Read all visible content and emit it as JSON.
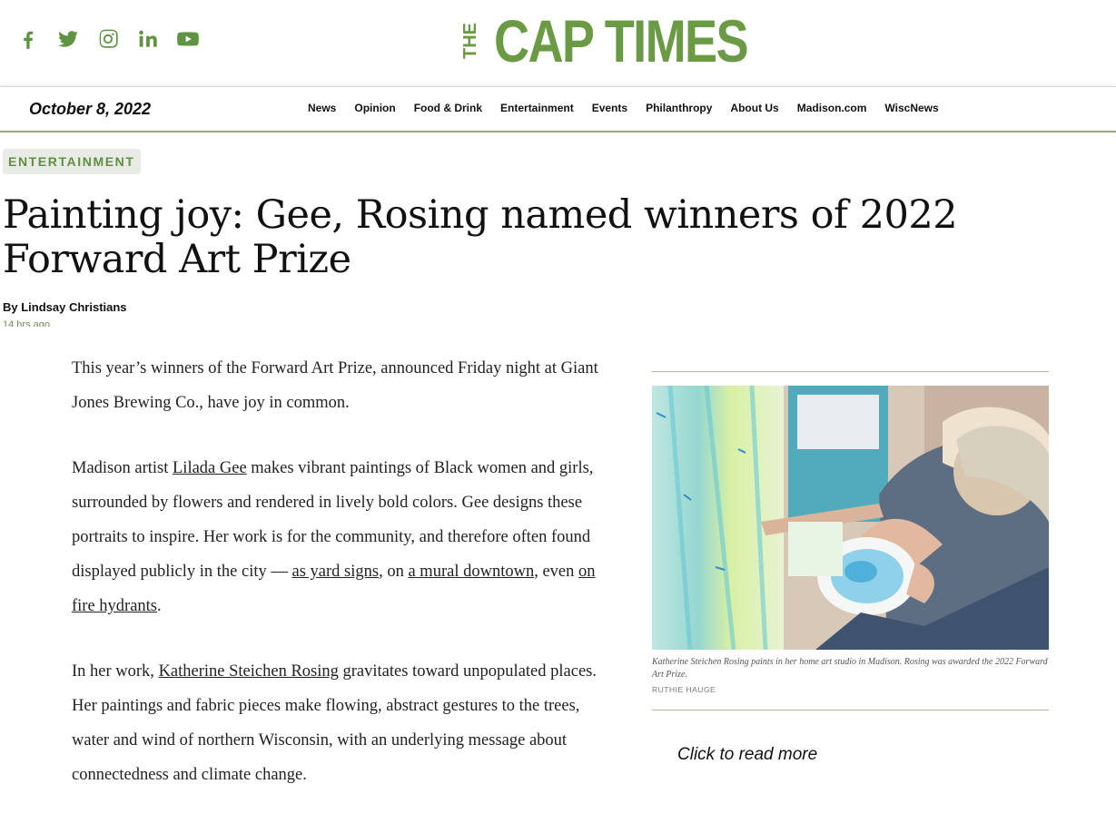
{
  "header": {
    "social": [
      "facebook-icon",
      "twitter-icon",
      "instagram-icon",
      "linkedin-icon",
      "youtube-icon"
    ],
    "logo_the": "THE",
    "logo_main": "CAP TIMES"
  },
  "navbar": {
    "date": "October 8, 2022",
    "items": [
      "News",
      "Opinion",
      "Food & Drink",
      "Entertainment",
      "Events",
      "Philanthropy",
      "About Us",
      "Madison.com",
      "WiscNews"
    ]
  },
  "article": {
    "category": "ENTERTAINMENT",
    "headline": "Painting joy: Gee, Rosing named winners of 2022 Forward Art Prize",
    "byline": "By Lindsay Christians",
    "timestamp": "14 hrs ago",
    "p1": "This year’s winners of the Forward Art Prize, announced Friday night at Giant Jones Brewing Co., have joy in common.",
    "p2_a": "Madison artist ",
    "p2_link1": "Lilada Gee",
    "p2_b": " makes vibrant paintings of Black women and girls, surrounded by flowers and rendered in lively bold colors. Gee designs these portraits to inspire. Her work is for the community, and therefore often found displayed publicly in the city — ",
    "p2_link2": "as yard signs",
    "p2_c": ", on ",
    "p2_link3": "a mural downtown",
    "p2_d": ", even ",
    "p2_link4": "on fire hydrants",
    "p2_e": ".",
    "p3_a": "In her work, ",
    "p3_link1": "Katherine Steichen Rosing",
    "p3_b": " gravitates toward unpopulated places. Her paintings and fabric pieces make flowing, abstract gestures to the trees, water and wind of northern Wisconsin, with an underlying message about connectedness and climate change."
  },
  "aside": {
    "caption": "Katherine Steichen Rosing paints in her home art studio in Madison. Rosing was awarded the 2022 Forward Art Prize.",
    "credit": "RUTHIE HAUGE",
    "cta": "Click to read more"
  },
  "colors": {
    "brand_green": "#6b9a45",
    "rule_green": "#8fb06e"
  }
}
